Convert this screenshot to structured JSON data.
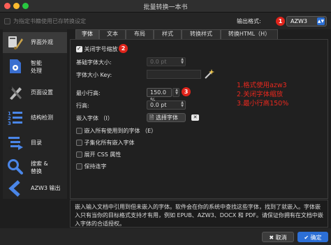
{
  "window": {
    "title": "批量转换一本书"
  },
  "top": {
    "use_previous": "为指定书籍使用已存转换设定",
    "output_label": "输出格式:",
    "output_value": "AZW3",
    "badge1": "1"
  },
  "sidebar": {
    "items": [
      {
        "label": "界面外观"
      },
      {
        "label": "智能",
        "label2": "处理"
      },
      {
        "label": "页面设置"
      },
      {
        "label": "结构检测"
      },
      {
        "label": "目录"
      },
      {
        "label": "搜索 &",
        "label2": "替换"
      },
      {
        "label": "AZW3 输出"
      }
    ]
  },
  "tabs": [
    "字体",
    "文本",
    "布局",
    "样式",
    "转换样式",
    "转换HTML（H）"
  ],
  "font_panel": {
    "disable_font_scaling": "关闭字号缩放",
    "badge2": "2",
    "base_font_label": "基础字体大小:",
    "base_font_value": "0.0 pt",
    "font_key_label": "字体大小 Key:",
    "min_line_label": "最小行高:",
    "min_line_value": "150.0 %",
    "badge3": "3",
    "line_height_label": "行高:",
    "line_height_value": "0.0 pt",
    "embed_font_label": "嵌入字体 （I）",
    "choose_font_button": "选择字体",
    "embed_all": "嵌入所有使用到的字体 （E）",
    "subset": "子集化所有嵌入字体",
    "expand_css": "展开 CSS 属性",
    "keep_ligatures": "保持连字"
  },
  "annotations": [
    "1.格式使用azw3",
    "2.关闭字体缩放",
    "3.最小行高150%"
  ],
  "help_text": "嵌入输入文档中引用到但未嵌入的字体。软件会在你的系统中查找这些字体，找到了就嵌入。字体嵌入只有当你的目标格式支持才有用，例如 EPUB、AZW3、DOCX 和 PDF。请保证你拥有在文档中嵌入字体的合适授权。",
  "footer": {
    "cancel": "取消",
    "ok": "确定"
  },
  "colors": {
    "accent": "#2c6fd6",
    "annotation": "#e8281e"
  }
}
